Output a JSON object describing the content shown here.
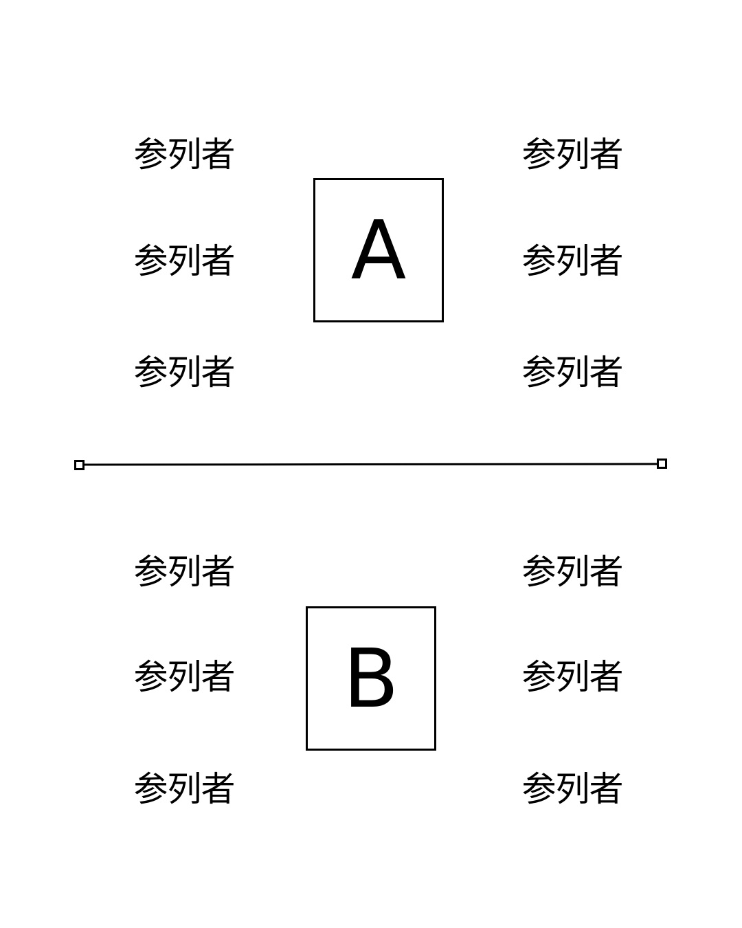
{
  "diagram": {
    "groups": [
      {
        "id": "A",
        "table_label": "A",
        "attendees_left": [
          "参列者",
          "参列者",
          "参列者"
        ],
        "attendees_right": [
          "参列者",
          "参列者",
          "参列者"
        ]
      },
      {
        "id": "B",
        "table_label": "B",
        "attendees_left": [
          "参列者",
          "参列者",
          "参列者"
        ],
        "attendees_right": [
          "参列者",
          "参列者",
          "参列者"
        ]
      }
    ],
    "colors": {
      "stroke": "#000000",
      "background": "#ffffff"
    }
  }
}
